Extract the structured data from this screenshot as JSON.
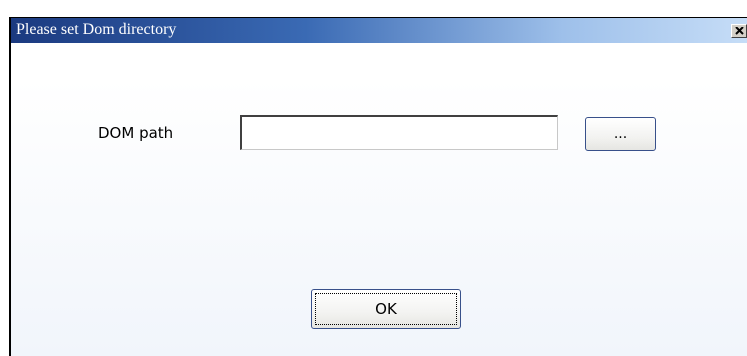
{
  "window": {
    "title": "Please set Dom directory",
    "close_icon": "close-icon"
  },
  "form": {
    "path_label": "DOM path",
    "path_value": "",
    "browse_label": "...",
    "ok_label": "OK"
  },
  "colors": {
    "titlebar_start": "#1b3a80",
    "titlebar_end": "#c6ddf7",
    "button_border": "#38508a"
  }
}
